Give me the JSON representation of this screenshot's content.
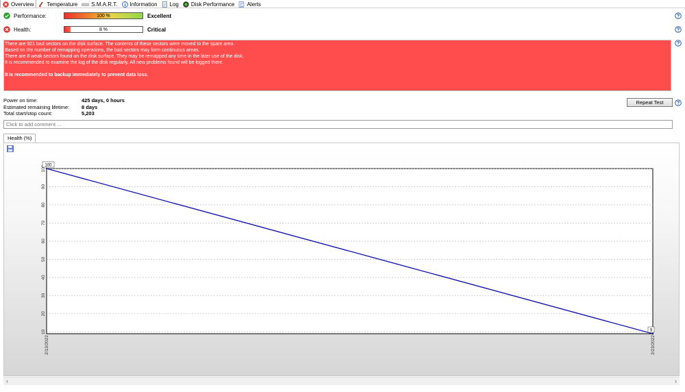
{
  "tabs": [
    {
      "label": "Overview",
      "icon": "red-x-icon",
      "active": true
    },
    {
      "label": "Temperature",
      "icon": "thermometer-icon"
    },
    {
      "label": "S.M.A.R.T.",
      "icon": "disk-icon"
    },
    {
      "label": "Information",
      "icon": "info-icon"
    },
    {
      "label": "Log",
      "icon": "log-icon"
    },
    {
      "label": "Disk Performance",
      "icon": "performance-icon"
    },
    {
      "label": "Alerts",
      "icon": "alerts-icon"
    }
  ],
  "performance": {
    "label": "Performance:",
    "value_text": "100 %",
    "value": 100,
    "rating": "Excellent",
    "status_icon": "green-check-icon"
  },
  "health": {
    "label": "Health:",
    "value_text": "8 %",
    "value": 8,
    "rating": "Critical",
    "status_icon": "red-x-icon"
  },
  "alert": {
    "lines": [
      "There are 921 bad sectors on the disk surface. The contents of these sectors were moved to the spare area.",
      "Based on the number of remapping operations, the bad sectors may form continuous areas.",
      "There are 8 weak sectors found on the disk surface. They may be remapped any time in the later use of the disk.",
      "It is recommended to examine the log of the disk regularly. All new problems found will be logged there."
    ],
    "recommendation": "It is recommended to backup immediately to prevent data loss.",
    "color": "#ff4c4c"
  },
  "stats": {
    "power_on_label": "Power on time:",
    "power_on_value": "425 days, 0 hours",
    "remaining_label": "Estimated remaining lifetime:",
    "remaining_value": "8 days",
    "startstop_label": "Total start/stop count:",
    "startstop_value": "5,203"
  },
  "repeat_test_label": "Repeat Test",
  "comment_placeholder": "Click to add comment ...",
  "chart_tab_label": "Health (%)",
  "chart_data": {
    "type": "line",
    "x": [
      "2/13/2022",
      "2/23/2022"
    ],
    "series": [
      {
        "values": [
          100,
          9
        ],
        "color": "#1a1aa8"
      }
    ],
    "data_labels": [
      "100",
      "9"
    ],
    "yticks": [
      10,
      20,
      30,
      40,
      50,
      60,
      70,
      80,
      90,
      100
    ],
    "ylim": [
      9,
      100
    ],
    "grid": true
  }
}
